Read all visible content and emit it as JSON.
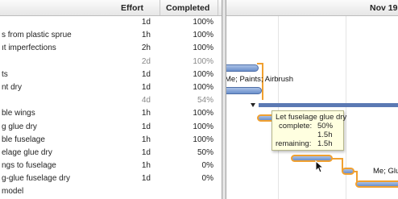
{
  "table": {
    "columns": {
      "effort": "Effort",
      "completed": "Completed"
    },
    "rows": [
      {
        "name": "",
        "effort": "1d",
        "completed": "100%",
        "group": false
      },
      {
        "name": "s from plastic sprue",
        "effort": "1h",
        "completed": "100%",
        "group": false
      },
      {
        "name": "ıt imperfections",
        "effort": "2h",
        "completed": "100%",
        "group": false
      },
      {
        "name": "",
        "effort": "2d",
        "completed": "100%",
        "group": true
      },
      {
        "name": "ts",
        "effort": "1d",
        "completed": "100%",
        "group": false
      },
      {
        "name": "nt dry",
        "effort": "1d",
        "completed": "100%",
        "group": false
      },
      {
        "name": "",
        "effort": "4d",
        "completed": "54%",
        "group": true
      },
      {
        "name": "ble wings",
        "effort": "1h",
        "completed": "100%",
        "group": false
      },
      {
        "name": "g glue dry",
        "effort": "1d",
        "completed": "100%",
        "group": false
      },
      {
        "name": "ble fuselage",
        "effort": "1h",
        "completed": "100%",
        "group": false
      },
      {
        "name": "elage glue dry",
        "effort": "1d",
        "completed": "50%",
        "group": false
      },
      {
        "name": "ngs to fuselage",
        "effort": "1h",
        "completed": "0%",
        "group": false
      },
      {
        "name": "g-glue fuselage dry",
        "effort": "1d",
        "completed": "0%",
        "group": false
      },
      {
        "name": "model",
        "effort": "",
        "completed": "",
        "group": false
      }
    ]
  },
  "gantt": {
    "header_date": "Nov 19",
    "labels": {
      "paints": "Me; Paints; Airbrush",
      "glue": "Me; Glu"
    },
    "tooltip": {
      "title": "Let fuselage glue dry",
      "complete_label": "complete:",
      "complete_value": "50%",
      "done_value": "1.5h",
      "remaining_label": "remaining:",
      "remaining_value": "1.5h"
    }
  },
  "colors": {
    "accent_orange": "#f0a030",
    "bar_blue": "#6b8fcb",
    "tooltip_bg": "#ffffe0"
  }
}
